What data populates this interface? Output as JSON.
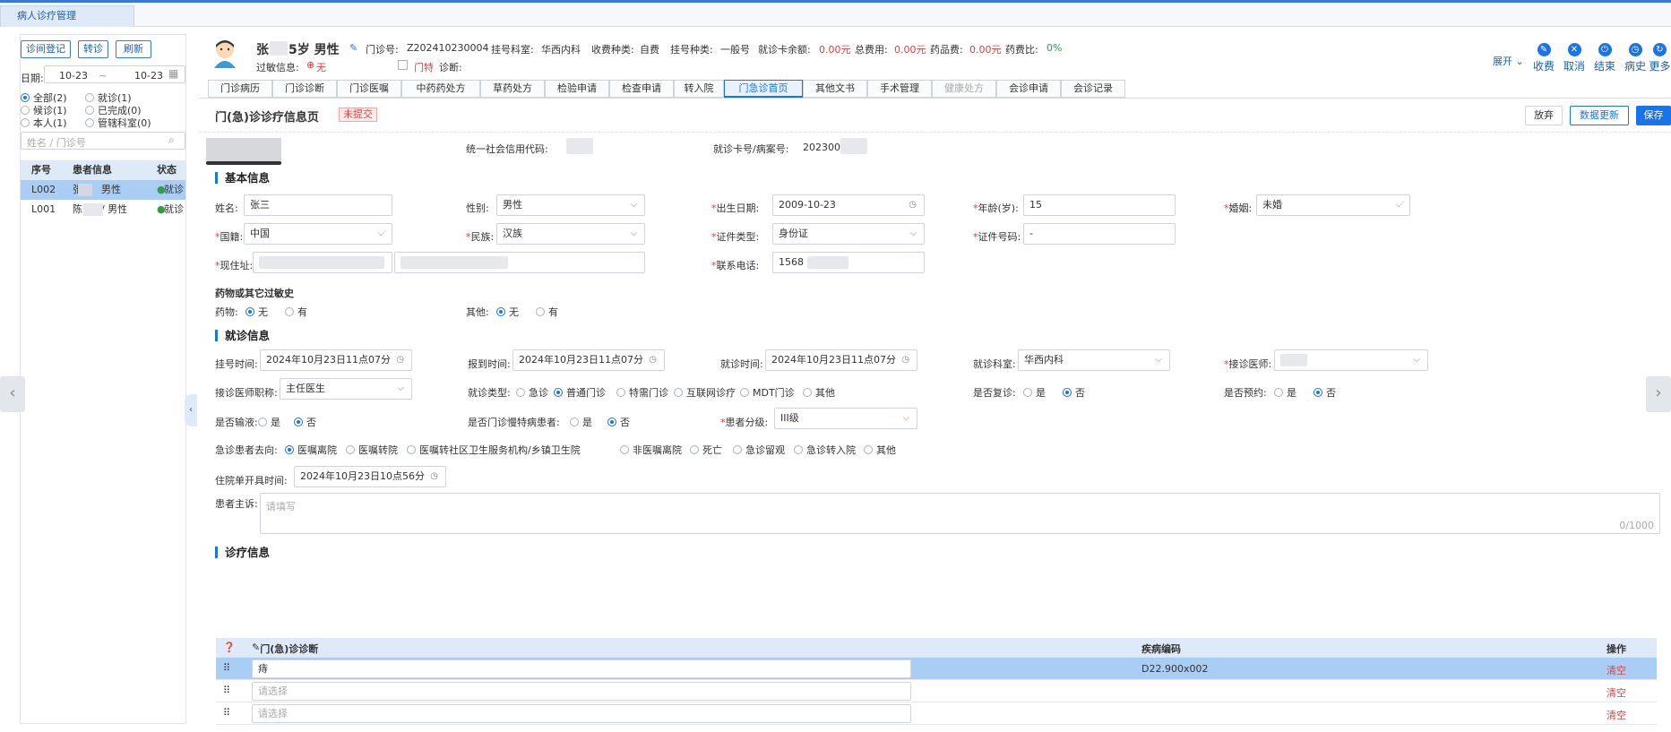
{
  "top": {
    "tab": "病人诊疗管理"
  },
  "left": {
    "buttons": [
      "诊间登记",
      "转诊",
      "刷新"
    ],
    "date_label": "日期:",
    "date_from": "10-23",
    "date_sep": "~",
    "date_to": "10-23",
    "filters": [
      {
        "label": "全部(2)",
        "on": true
      },
      {
        "label": "就诊(1)",
        "on": false
      },
      {
        "label": "候诊(1)",
        "on": false
      },
      {
        "label": "已完成(0)",
        "on": false
      },
      {
        "label": "本人(1)",
        "on": false
      },
      {
        "label": "管辖科室(0)",
        "on": false
      }
    ],
    "search_placeholder": "姓名 / 门诊号",
    "table": {
      "cols": [
        "序号",
        "患者信息",
        "状态"
      ],
      "rows": [
        {
          "no": "L002",
          "info": "张      男性",
          "status": "就诊"
        },
        {
          "no": "L001",
          "info": "陈      / 男性",
          "status": "就诊"
        }
      ]
    }
  },
  "patient": {
    "name": "张",
    "age_sex": "5岁 男性",
    "clinic_label": "门诊号:",
    "clinic_no": "Z202410230004",
    "dept_label": "挂号科室:",
    "dept": "华西内科",
    "fee_label": "收费种类:",
    "fee": "自费",
    "reg_label": "挂号种类:",
    "reg": "一般号",
    "card_label": "就诊卡余额:",
    "card": "0.00元",
    "total_label": "总费用:",
    "total": "0.00元",
    "drug_label": "药品费:",
    "drug": "0.00元",
    "ratio_label": "药费比:",
    "ratio": "0%",
    "allergy_label": "过敏信息:",
    "allergy": "无",
    "special_label": "门特",
    "diag_label": "诊断:"
  },
  "toolbar": {
    "expand": "展开",
    "items": [
      "收费",
      "取消",
      "结束",
      "病史",
      "更多"
    ]
  },
  "tabs": [
    "门诊病历",
    "门诊诊断",
    "门诊医嘱",
    "中药药处方",
    "草药处方",
    "检验申请",
    "检查申请",
    "转入院",
    "门急诊首页",
    "其他文书",
    "手术管理",
    "健康处方",
    "会诊申请",
    "会诊记录"
  ],
  "page": {
    "title": "门(急)诊诊疗信息页",
    "status": "未提交",
    "btn_abandon": "放弃",
    "btn_update": "数据更新",
    "btn_save": "保存",
    "credit_label": "统一社会信用代码:",
    "card_label": "就诊卡号/病案号:",
    "card_no": "202300"
  },
  "basic": {
    "title": "基本信息",
    "name_label": "姓名:",
    "name": "张三",
    "sex_label": "性别:",
    "sex": "男性",
    "birth_label": "出生日期:",
    "birth": "2009-10-23",
    "age_label": "年龄(岁):",
    "age": "15",
    "marriage_label": "婚姻:",
    "marriage": "未婚",
    "nation_label": "国籍:",
    "nation": "中国",
    "ethnic_label": "民族:",
    "ethnic": "汉族",
    "idtype_label": "证件类型:",
    "idtype": "身份证",
    "idno_label": "证件号码:",
    "idno": "-",
    "addr_label": "现住址:",
    "phone_label": "联系电话:",
    "phone": "1568",
    "allergy_title": "药物或其它过敏史",
    "drug_label": "药物:",
    "other_label": "其他:",
    "none": "无",
    "has": "有"
  },
  "visit": {
    "title": "就诊信息",
    "reg_time_label": "挂号时间:",
    "reg_time": "2024年10月23日11点07分",
    "arrive_label": "报到时间:",
    "arrive": "2024年10月23日11点07分",
    "visit_time_label": "就诊时间:",
    "visit_time": "2024年10月23日11点07分",
    "dept_label": "就诊科室:",
    "dept": "华西内科",
    "doctor_label": "接诊医师:",
    "title_label": "接诊医师职称:",
    "doctitle": "主任医生",
    "type_label": "就诊类型:",
    "types": [
      "急诊",
      "普通门诊",
      "特需门诊",
      "互联网诊疗",
      "MDT门诊",
      "其他"
    ],
    "revisit_label": "是否复诊:",
    "appoint_label": "是否预约:",
    "yes": "是",
    "no": "否",
    "transfusion_label": "是否输液:",
    "chronic_label": "是否门诊慢特病患者:",
    "grade_label": "患者分级:",
    "grade": "III级",
    "dest_label": "急诊患者去向:",
    "dests": [
      "医嘱离院",
      "医嘱转院",
      "医嘱转社区卫生服务机构/乡镇卫生院",
      "非医嘱离院",
      "死亡",
      "急诊留观",
      "急诊转入院",
      "其他"
    ],
    "admit_label": "住院单开具时间:",
    "admit": "2024年10月23日10点56分",
    "complaint_label": "患者主诉:",
    "complaint_placeholder": "请填写",
    "counter": "0/1000"
  },
  "diagnosis": {
    "title": "诊疗信息",
    "cols": {
      "diag": "门(急)诊诊断",
      "code": "疾病编码",
      "op": "操作"
    },
    "rows": [
      {
        "diag": "痔",
        "code": "D22.900x002",
        "op": "清空"
      },
      {
        "diag": "",
        "placeholder": "请选择",
        "code": "",
        "op": "清空"
      },
      {
        "diag": "",
        "placeholder": "请选择",
        "code": "",
        "op": "清空"
      }
    ]
  }
}
